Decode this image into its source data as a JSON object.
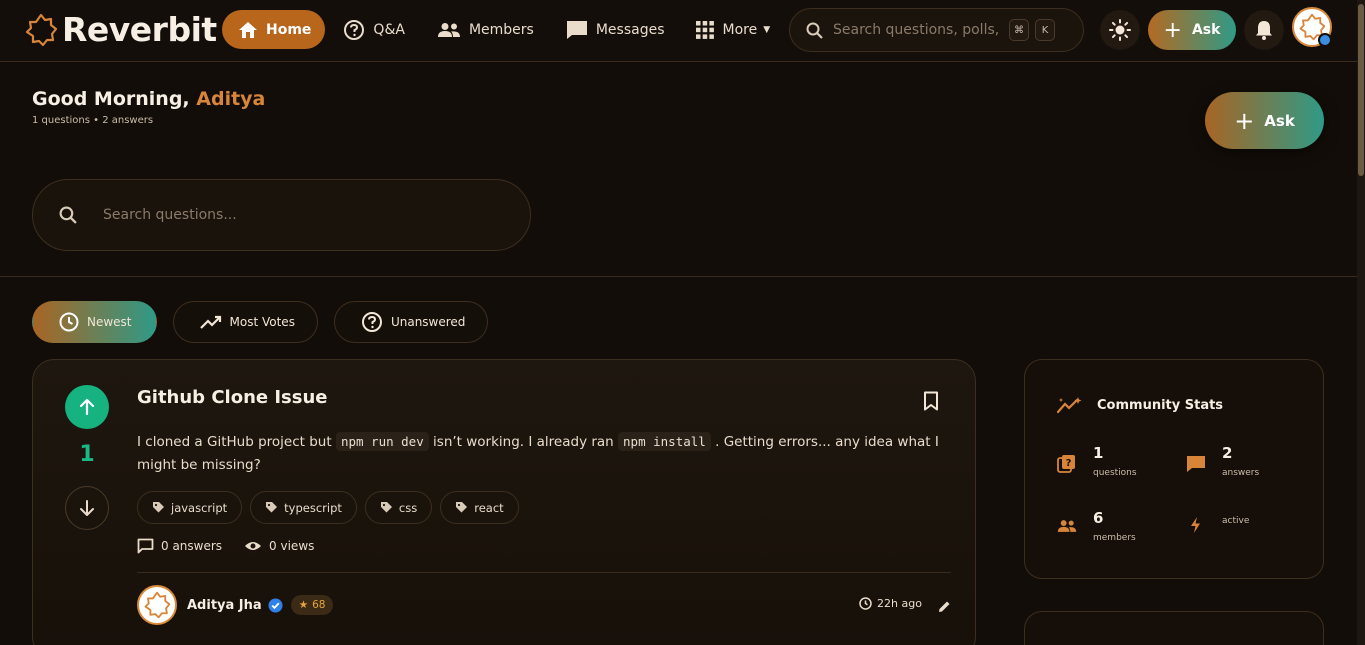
{
  "brand": {
    "name": "Reverbit"
  },
  "nav": {
    "items": [
      {
        "label": "Home"
      },
      {
        "label": "Q&A"
      },
      {
        "label": "Members"
      },
      {
        "label": "Messages"
      },
      {
        "label": "More"
      }
    ]
  },
  "top_search": {
    "placeholder": "Search questions, polls, eve",
    "kbd1": "⌘",
    "kbd2": "K"
  },
  "top_actions": {
    "ask_label": "Ask"
  },
  "greeting": {
    "prefix": "Good Morning,",
    "name": "Aditya",
    "subline": "1 questions • 2 answers"
  },
  "hero": {
    "ask_label": "Ask"
  },
  "main_search": {
    "placeholder": "Search questions..."
  },
  "filters": [
    {
      "label": "Newest",
      "active": true
    },
    {
      "label": "Most Votes",
      "active": false
    },
    {
      "label": "Unanswered",
      "active": false
    }
  ],
  "question": {
    "votes": "1",
    "title": "Github Clone Issue",
    "body_1": "I cloned a GitHub project but",
    "code_1": "npm run dev",
    "body_2": "isn’t working. I already ran",
    "code_2": "npm install",
    "body_3": ". Getting errors... any idea what I might be missing?",
    "tags": [
      "javascript",
      "typescript",
      "css",
      "react"
    ],
    "answers": "0 answers",
    "views": "0 views",
    "author": "Aditya Jha",
    "reputation": "68",
    "time": "22h ago"
  },
  "community_stats": {
    "title": "Community Stats",
    "questions_num": "1",
    "questions_lbl": "questions",
    "answers_num": "2",
    "answers_lbl": "answers",
    "members_num": "6",
    "members_lbl": "members",
    "active_lbl": "active"
  },
  "colors": {
    "accent": "#b8661c",
    "teal": "#2f9a87",
    "upvote": "#16b27f",
    "background": "#120d08"
  }
}
